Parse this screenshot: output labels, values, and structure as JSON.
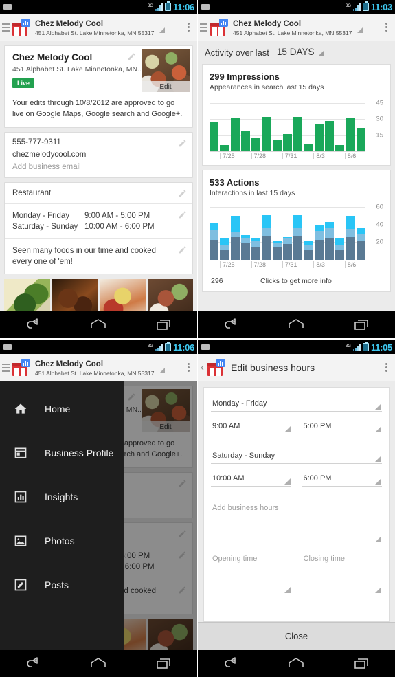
{
  "panels": {
    "profile": {
      "status": {
        "time": "11:06",
        "network": "3G"
      },
      "actionbar": {
        "title": "Chez Melody Cool",
        "subtitle": "451 Alphabet St. Lake Minnetonka, MN 55317",
        "logo_icon": "google-places-icon",
        "menu_icon": "hamburger-icon",
        "overflow_icon": "overflow-menu-icon"
      },
      "business_card": {
        "name": "Chez Melody Cool",
        "address": "451 Alphabet St. Lake Minnetonka, MN...",
        "badge": "Live",
        "photo_edit_label": "Edit",
        "approval_text": "Your edits through 10/8/2012 are approved to go live on Google Maps, Google search and Google+."
      },
      "contact_card": {
        "phone": "555-777-9311",
        "website": "chezmelodycool.com",
        "email_placeholder": "Add business email"
      },
      "category": "Restaurant",
      "hours": [
        {
          "days": "Monday - Friday",
          "time": "9:00 AM - 5:00 PM"
        },
        {
          "days": "Saturday - Sunday",
          "time": "10:00 AM - 6:00 PM"
        }
      ],
      "description": "Seen many foods in our time and cooked every one of 'em!",
      "photos": [
        "greens-photo",
        "ribs-photo",
        "noodles-photo",
        "seafood-photo"
      ]
    },
    "insights": {
      "status": {
        "time": "11:03",
        "network": "3G"
      },
      "actionbar": {
        "title": "Chez Melody Cool",
        "subtitle": "451 Alphabet St. Lake Minnetonka, MN 55317"
      },
      "header": {
        "label": "Activity over last",
        "range": "15 DAYS"
      },
      "clicks": {
        "count": "296",
        "label": "Clicks to get more info"
      }
    },
    "drawer": {
      "status": {
        "time": "11:06",
        "network": "3G"
      },
      "items": [
        {
          "label": "Home",
          "icon": "home-icon"
        },
        {
          "label": "Business Profile",
          "icon": "business-profile-icon"
        },
        {
          "label": "Insights",
          "icon": "insights-bar-chart-icon"
        },
        {
          "label": "Photos",
          "icon": "photos-icon"
        },
        {
          "label": "Posts",
          "icon": "posts-pencil-icon"
        }
      ]
    },
    "edit_hours": {
      "status": {
        "time": "11:05",
        "network": "3G"
      },
      "title": "Edit business hours",
      "back_icon": "back-chevron-icon",
      "rows": [
        {
          "days": "Monday - Friday",
          "open": "9:00 AM",
          "close": "5:00 PM"
        },
        {
          "days": "Saturday - Sunday",
          "open": "10:00 AM",
          "close": "6:00 PM"
        }
      ],
      "add_row": {
        "days_placeholder": "Add business hours",
        "open_placeholder": "Opening time",
        "close_placeholder": "Closing time"
      },
      "close_button": "Close"
    }
  },
  "navbar": {
    "back": "back-icon",
    "home": "home-icon",
    "recents": "recents-icon"
  },
  "colors": {
    "impressions_green": "#1aa85a",
    "actions_dark": "#5a7a94",
    "actions_mid": "#7fbee0",
    "actions_light": "#29c5f6",
    "live_green": "#22a14f",
    "accent_blue": "#3ec8f0"
  },
  "chart_data": [
    {
      "type": "bar",
      "title": "299 Impressions",
      "subtitle": "Appearances in search last 15 days",
      "xlabel": "",
      "ylabel": "",
      "ylim": [
        0,
        50
      ],
      "grid": true,
      "yticks": [
        15,
        30,
        45
      ],
      "categories": [
        "7/24",
        "7/25",
        "7/26",
        "7/27",
        "7/28",
        "7/29",
        "7/30",
        "7/31",
        "8/1",
        "8/2",
        "8/3",
        "8/4",
        "8/5",
        "8/6",
        "8/7"
      ],
      "tick_labels": [
        "7/25",
        "7/28",
        "7/31",
        "8/3",
        "8/6"
      ],
      "tick_label_indices": [
        1,
        4,
        7,
        10,
        13
      ],
      "values": [
        27,
        6,
        31,
        19,
        12,
        32,
        10,
        16,
        32,
        7,
        25,
        28,
        6,
        31,
        22
      ],
      "color": "#1aa85a",
      "legend": []
    },
    {
      "type": "bar",
      "stacked": true,
      "title": "533 Actions",
      "subtitle": "Interactions in last 15 days",
      "xlabel": "",
      "ylabel": "",
      "ylim": [
        0,
        64
      ],
      "grid": true,
      "yticks": [
        20,
        40,
        60
      ],
      "categories": [
        "7/24",
        "7/25",
        "7/26",
        "7/27",
        "7/28",
        "7/29",
        "7/30",
        "7/31",
        "8/1",
        "8/2",
        "8/3",
        "8/4",
        "8/5",
        "8/6",
        "8/7"
      ],
      "tick_labels": [
        "7/25",
        "7/28",
        "7/31",
        "8/3",
        "8/6"
      ],
      "tick_label_indices": [
        1,
        4,
        7,
        10,
        13
      ],
      "series": [
        {
          "name": "clicks-dark",
          "color": "#5a7a94",
          "values": [
            23,
            11,
            26,
            19,
            15,
            27,
            14,
            18,
            27,
            11,
            23,
            25,
            11,
            26,
            21
          ]
        },
        {
          "name": "clicks-mid",
          "color": "#7fbee0",
          "values": [
            11,
            6,
            6,
            6,
            6,
            9,
            5,
            6,
            9,
            6,
            10,
            11,
            6,
            9,
            9
          ]
        },
        {
          "name": "clicks-light",
          "color": "#29c5f6",
          "values": [
            7,
            8,
            18,
            3,
            4,
            15,
            3,
            2,
            15,
            5,
            7,
            7,
            8,
            15,
            6
          ]
        }
      ],
      "footer": {
        "value": "296",
        "label": "Clicks to get more info"
      }
    }
  ]
}
